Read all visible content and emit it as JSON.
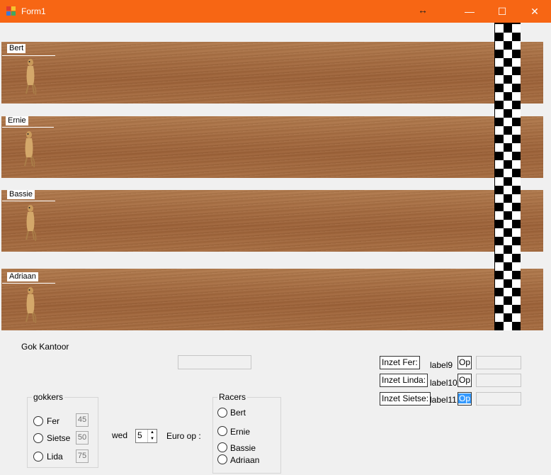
{
  "window": {
    "title": "Form1",
    "resize_glyph": "↔",
    "minimize_label": "—",
    "maximize_label": "☐",
    "close_label": "✕"
  },
  "lanes": [
    {
      "name": "Bert"
    },
    {
      "name": "Ernie"
    },
    {
      "name": "Bassie"
    },
    {
      "name": "Adriaan"
    }
  ],
  "betting_office": {
    "label": "Gok Kantoor"
  },
  "gamblers": {
    "title": "gokkers",
    "items": [
      {
        "name": "Fer",
        "amount": "45"
      },
      {
        "name": "Sietse",
        "amount": "50"
      },
      {
        "name": "Lida",
        "amount": "75"
      }
    ]
  },
  "bet": {
    "wed_label": "wed",
    "amount": "5",
    "euro_label": "Euro op :"
  },
  "racers": {
    "title": "Racers",
    "items": [
      "Bert",
      "Ernie",
      "Bassie",
      "Adriaan"
    ]
  },
  "bets_summary": [
    {
      "label": "Inzet Fer:",
      "value_label": "label9",
      "op": "Op"
    },
    {
      "label": "Inzet Linda:",
      "value_label": "label10",
      "op": "Op"
    },
    {
      "label": "Inzet Sietse:",
      "value_label": "label11",
      "op": "Op"
    }
  ],
  "colors": {
    "titlebar": "#f76614",
    "track": "#a56a3e",
    "selection": "#3399ff"
  }
}
